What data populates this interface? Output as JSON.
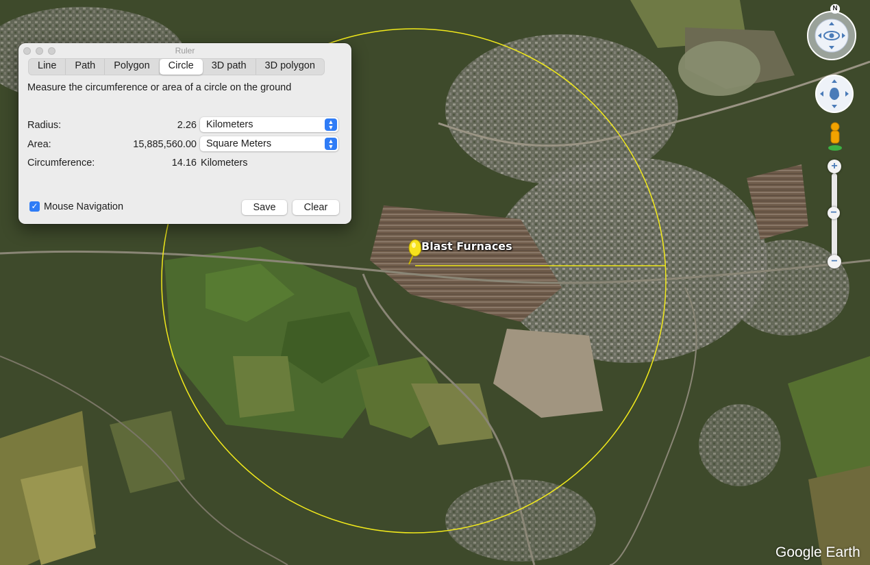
{
  "ruler": {
    "title": "Ruler",
    "tabs": [
      {
        "label": "Line"
      },
      {
        "label": "Path"
      },
      {
        "label": "Polygon"
      },
      {
        "label": "Circle",
        "active": true
      },
      {
        "label": "3D path"
      },
      {
        "label": "3D polygon"
      }
    ],
    "description": "Measure the circumference or area of a circle on the ground",
    "radius": {
      "label": "Radius:",
      "value": "2.26",
      "unit": "Kilometers"
    },
    "area": {
      "label": "Area:",
      "value": "15,885,560.00",
      "unit": "Square Meters"
    },
    "circumference": {
      "label": "Circumference:",
      "value": "14.16",
      "unit": "Kilometers"
    },
    "mouse_navigation": {
      "label": "Mouse Navigation",
      "checked": true
    },
    "save_label": "Save",
    "clear_label": "Clear"
  },
  "map": {
    "placemark_label": "Blast Furnaces",
    "circle_color": "#f2ea1b"
  },
  "nav": {
    "north_label": "N",
    "zoom_in": "+",
    "zoom_out": "−"
  },
  "brand": {
    "logo_text": "Google Earth"
  }
}
